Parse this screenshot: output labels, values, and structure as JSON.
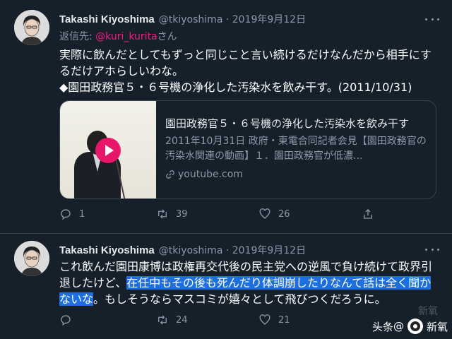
{
  "tweets": [
    {
      "author_name": "Takashi Kiyoshima",
      "meta": "@tkiyoshima · 2019年9月12日",
      "reply_prefix": "返信先: ",
      "reply_mention": "@kuri_kurita",
      "reply_suffix": "さん",
      "body_line1": "実際に飲んだとしてもずっと同じこと言い続けるだけなんだから相手にす",
      "body_line2": "るだけアホらしいわな。",
      "body_line3": "◆園田政務官５・６号機の浄化した汚染水を飲み干す。(2011/10/31)",
      "card": {
        "title": "園田政務官５・６号機の浄化した汚染水を飲み干す",
        "description": "2011年10月31日 政府・東電合同記者会見【園田政務官の汚染水関連の動画】１．園田政務官が低濃...",
        "domain": "youtube.com"
      },
      "counts": {
        "replies": "1",
        "retweets": "39",
        "likes": "26"
      }
    },
    {
      "author_name": "Takashi Kiyoshima",
      "meta": "@tkiyoshima · 2019年9月12日",
      "body_line1": "これ飲んだ園田康博は政権再交代後の民主党への逆風で負け続けて政界引",
      "body_line2_plain": "退したけど、",
      "body_line2_hl": "在任中もその後も死んだり体調崩したりなんて話は全く聞か",
      "body_line3_hl": "ないな",
      "body_line3_plain": "。もしそうならマスコミが嬉々として飛びつくだろうに。",
      "counts": {
        "replies": "",
        "retweets": "24",
        "likes": "21"
      }
    }
  ],
  "watermark": {
    "prefix": "头条",
    "at": "@",
    "name": "新氧",
    "faint": "新氧"
  },
  "colors": {
    "background": "#15202b",
    "highlight": "#1d6fe0",
    "mention": "#f91880",
    "muted": "#8b98a5",
    "play_button": "#e8166a"
  },
  "icons": [
    "more-icon",
    "reply-icon",
    "retweet-icon",
    "like-icon",
    "share-icon",
    "link-icon",
    "play-icon"
  ]
}
